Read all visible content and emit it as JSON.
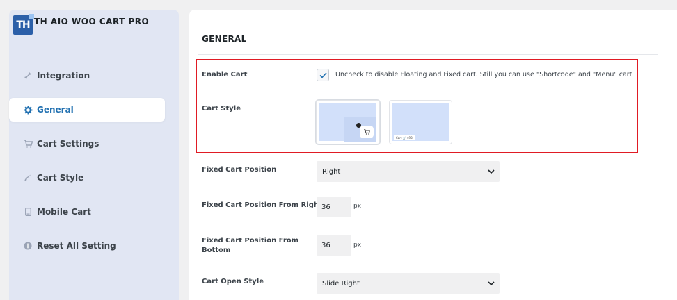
{
  "brand": {
    "logo_text": "TH",
    "name": "TH AIO WOO CART PRO"
  },
  "sidebar": {
    "items": [
      {
        "label": "Integration",
        "icon": "pin-icon",
        "glyph": "✎",
        "active": false
      },
      {
        "label": "General",
        "icon": "gear-icon",
        "glyph": "⚙",
        "active": true
      },
      {
        "label": "Cart Settings",
        "icon": "cart-icon",
        "glyph": "🛒",
        "active": false
      },
      {
        "label": "Cart Style",
        "icon": "brush-icon",
        "glyph": "✎",
        "active": false
      },
      {
        "label": "Mobile Cart",
        "icon": "mobile-icon",
        "glyph": "▯",
        "active": false
      },
      {
        "label": "Reset All Setting",
        "icon": "alert-icon",
        "glyph": "●",
        "active": false
      }
    ]
  },
  "main": {
    "section_title": "GENERAL",
    "enable_cart": {
      "label": "Enable Cart",
      "checked": true,
      "help": "Uncheck to disable Floating and Fixed cart. Still you can use \"Shortcode\" and \"Menu\" cart"
    },
    "cart_style": {
      "label": "Cart Style",
      "options": [
        {
          "name": "floating-cart",
          "selected": true
        },
        {
          "name": "menu-cart",
          "selected": false,
          "preview_text": "Cart 🛒 $98"
        }
      ]
    },
    "fixed_cart_position": {
      "label": "Fixed Cart Position",
      "value": "Right"
    },
    "position_from_right": {
      "label": "Fixed Cart Position From Right",
      "value": "36",
      "unit": "px"
    },
    "position_from_bottom": {
      "label_line1": "Fixed Cart Position From",
      "label_line2": "Bottom",
      "value": "36",
      "unit": "px"
    },
    "cart_open_style": {
      "label": "Cart Open Style",
      "value": "Slide Right"
    }
  },
  "colors": {
    "accent": "#2271b1",
    "highlight_border": "#e01b24",
    "sidebar_bg": "#e1e6f3"
  }
}
